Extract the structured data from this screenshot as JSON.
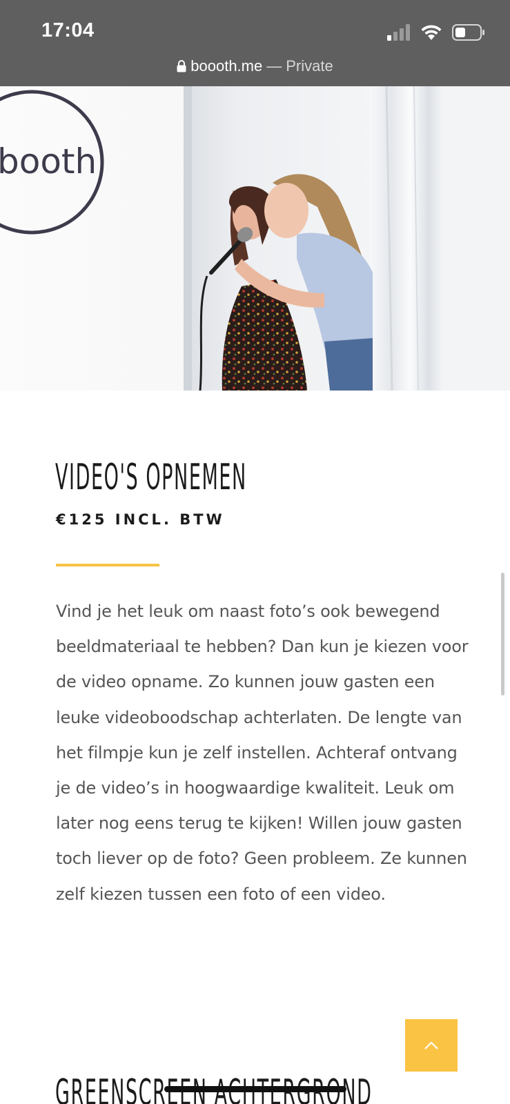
{
  "status_bar": {
    "time": "17:04",
    "icons": [
      "cellular-signal-icon",
      "wifi-icon",
      "battery-icon"
    ]
  },
  "url_bar": {
    "lock_icon": "lock-icon",
    "domain": "boooth.me",
    "separator": "—",
    "mode": "Private"
  },
  "hero": {
    "logo_text": "booth",
    "description": "two women singing into a microphone in a photobooth"
  },
  "section": {
    "title": "VIDEO'S OPNEMEN",
    "price": "€125 INCL. BTW",
    "body": "Vind je het leuk om naast foto’s ook bewegend beeldmateriaal te hebben? Dan kun je kiezen voor de video opname. Zo kunnen jouw gasten een leuke videoboodschap achterlaten. De lengte van het filmpje kun je zelf instellen. Achteraf ontvang je de video’s in hoogwaardige kwaliteit. Leuk om later nog eens terug te kijken! Willen jouw gasten toch liever op de foto? Geen probleem. Ze kunnen zelf kiezen tussen een foto of een video."
  },
  "next_section": {
    "title": "GREENSCREEN ACHTERGROND"
  },
  "back_to_top": {
    "icon": "chevron-up-icon"
  },
  "colors": {
    "accent": "#f6c445",
    "status_bar": "#5f5f5f"
  }
}
